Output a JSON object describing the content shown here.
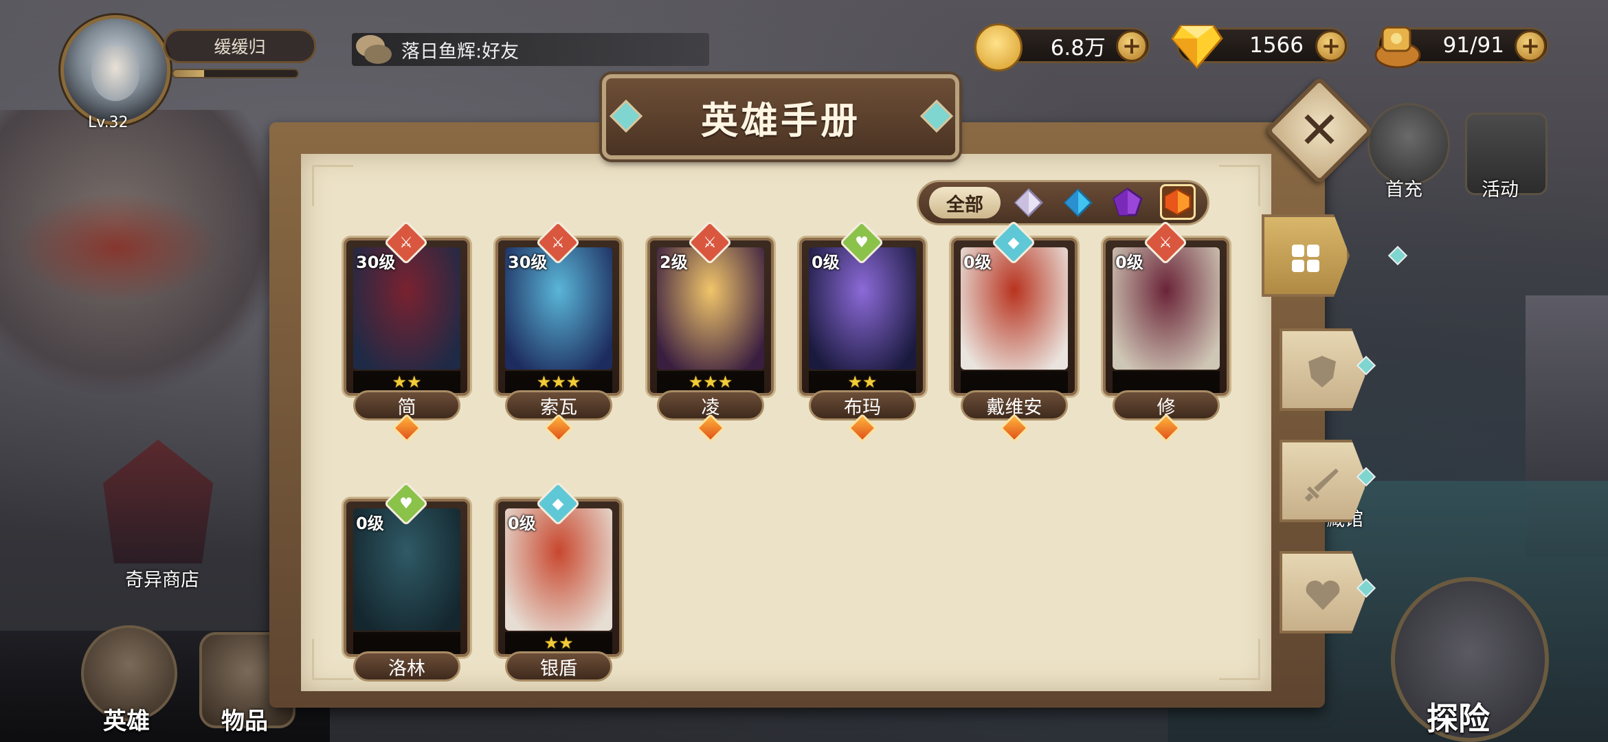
{
  "player": {
    "name": "缓缓归",
    "level": "Lv.32",
    "xp_fraction": 0.25
  },
  "chat": {
    "message": "落日鱼辉:好友"
  },
  "currencies": {
    "gold": "6.8万",
    "diamonds": "1566",
    "stamina": "91/91"
  },
  "side_menu": {
    "first_recharge": "首充",
    "events": "活动",
    "museum_partial": "藏馆"
  },
  "map_labels": {
    "strange_shop": "奇异商店"
  },
  "bottom_nav": {
    "heroes": "英雄",
    "items": "物品",
    "explore": "探险"
  },
  "panel": {
    "title": "英雄手册",
    "filter_all": "全部",
    "filters": [
      "white-gem-icon",
      "blue-gem-icon",
      "purple-gem-icon",
      "orange-gem-icon"
    ],
    "side_tabs": [
      "grid-icon",
      "shield-icon",
      "sword-icon",
      "heart-icon"
    ]
  },
  "heroes": [
    {
      "name": "简",
      "level": "30级",
      "stars": "★★",
      "class": "sword",
      "class_color": "#d9573e",
      "rarity": "orange",
      "portrait": [
        "#7a2230",
        "#1e2a46"
      ]
    },
    {
      "name": "索瓦",
      "level": "30级",
      "stars": "★★★",
      "class": "sword",
      "class_color": "#d9573e",
      "rarity": "orange",
      "portrait": [
        "#5ab6d8",
        "#1d2c5e"
      ]
    },
    {
      "name": "凌",
      "level": "2级",
      "stars": "★★★",
      "class": "sword",
      "class_color": "#d9573e",
      "rarity": "orange",
      "portrait": [
        "#f0c56a",
        "#3a1e40"
      ]
    },
    {
      "name": "布玛",
      "level": "0级",
      "stars": "★★",
      "class": "heart",
      "class_color": "#8ac24a",
      "rarity": "orange",
      "portrait": [
        "#8c6ad8",
        "#1a1a3e"
      ]
    },
    {
      "name": "戴维安",
      "level": "0级",
      "stars": "",
      "class": "shield",
      "class_color": "#5ec8d6",
      "rarity": "orange",
      "portrait": [
        "#b8331f",
        "#e9e4de"
      ]
    },
    {
      "name": "修",
      "level": "0级",
      "stars": "",
      "class": "sword",
      "class_color": "#d9573e",
      "rarity": "orange",
      "portrait": [
        "#6a2438",
        "#cfc7b6"
      ]
    },
    {
      "name": "洛林",
      "level": "0级",
      "stars": "",
      "class": "heart",
      "class_color": "#8ac24a",
      "rarity": "",
      "portrait": [
        "#2f5a66",
        "#14262e"
      ]
    },
    {
      "name": "银盾",
      "level": "0级",
      "stars": "★★",
      "class": "shield",
      "class_color": "#5ec8d6",
      "rarity": "",
      "portrait": [
        "#c8472e",
        "#e6ddd3"
      ]
    }
  ]
}
